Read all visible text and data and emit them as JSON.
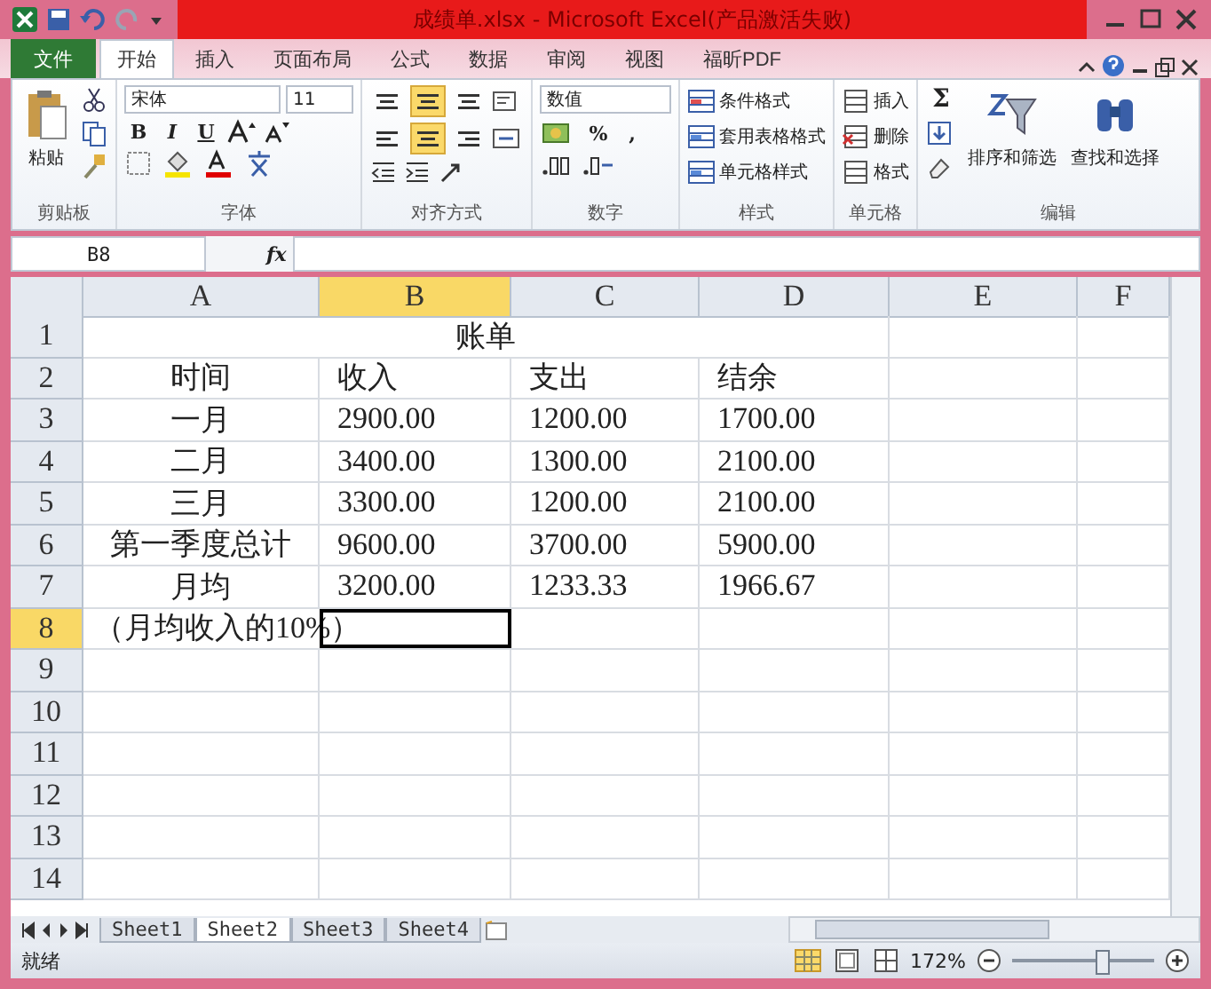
{
  "window": {
    "title": "成绩单.xlsx - Microsoft Excel(产品激活失败)"
  },
  "ribbon_tabs": [
    {
      "label": "文件",
      "kind": "file",
      "selected": false
    },
    {
      "label": "开始",
      "kind": "tab",
      "selected": true
    },
    {
      "label": "插入",
      "kind": "tab",
      "selected": false
    },
    {
      "label": "页面布局",
      "kind": "tab",
      "selected": false
    },
    {
      "label": "公式",
      "kind": "tab",
      "selected": false
    },
    {
      "label": "数据",
      "kind": "tab",
      "selected": false
    },
    {
      "label": "审阅",
      "kind": "tab",
      "selected": false
    },
    {
      "label": "视图",
      "kind": "tab",
      "selected": false
    },
    {
      "label": "福昕PDF",
      "kind": "tab",
      "selected": false
    }
  ],
  "clipboard": {
    "label": "剪贴板",
    "paste": "粘贴"
  },
  "font": {
    "label": "字体",
    "font_name": "宋体",
    "font_size": "11",
    "bold": "B",
    "italic": "I",
    "underline": "U"
  },
  "alignment": {
    "label": "对齐方式",
    "vertical_align": [
      {
        "selected": false
      },
      {
        "selected": true
      },
      {
        "selected": false
      }
    ],
    "horizontal_align": [
      {
        "selected": false
      },
      {
        "selected": true
      },
      {
        "selected": false
      }
    ]
  },
  "number": {
    "label": "数字",
    "format": "数值",
    "percent": "%",
    "comma": ","
  },
  "styles": {
    "label": "样式",
    "items": [
      "条件格式",
      "套用表格格式",
      "单元格样式"
    ]
  },
  "cells": {
    "label": "单元格",
    "items": [
      "插入",
      "删除",
      "格式"
    ]
  },
  "editing": {
    "label": "编辑",
    "sigma": "Σ",
    "items": [
      "排序和筛选",
      "查找和选择"
    ]
  },
  "formula_bar": {
    "name_box": "B8",
    "function_label": "fx"
  },
  "columns": [
    {
      "label": "A",
      "selected": false
    },
    {
      "label": "B",
      "selected": true
    },
    {
      "label": "C",
      "selected": false
    },
    {
      "label": "D",
      "selected": false
    },
    {
      "label": "E",
      "selected": false
    },
    {
      "label": "F",
      "selected": false
    }
  ],
  "rows": [
    {
      "number": "1",
      "selected": false,
      "kind": "merged",
      "text": "账单"
    },
    {
      "number": "2",
      "selected": false,
      "cells": [
        "时间",
        "收入",
        "支出",
        "结余"
      ]
    },
    {
      "number": "3",
      "selected": false,
      "cells": [
        "一月",
        "2900.00",
        "1200.00",
        "1700.00"
      ]
    },
    {
      "number": "4",
      "selected": false,
      "cells": [
        "二月",
        "3400.00",
        "1300.00",
        "2100.00"
      ]
    },
    {
      "number": "5",
      "selected": false,
      "cells": [
        "三月",
        "3300.00",
        "1200.00",
        "2100.00"
      ]
    },
    {
      "number": "6",
      "selected": false,
      "cells": [
        "第一季度总计",
        "9600.00",
        "3700.00",
        "5900.00"
      ]
    },
    {
      "number": "7",
      "selected": false,
      "cells": [
        "月均",
        "3200.00",
        "1233.33",
        "1966.67"
      ]
    },
    {
      "number": "8",
      "selected": true,
      "cells": [
        "（月均收入的10%）"
      ]
    },
    {
      "number": "9",
      "selected": false,
      "cells": []
    },
    {
      "number": "10",
      "selected": false,
      "cells": []
    },
    {
      "number": "11",
      "selected": false,
      "cells": []
    },
    {
      "number": "12",
      "selected": false,
      "cells": []
    },
    {
      "number": "13",
      "selected": false,
      "cells": []
    },
    {
      "number": "14",
      "selected": false,
      "cells": []
    }
  ],
  "sheets": [
    {
      "label": "Sheet1",
      "selected": false
    },
    {
      "label": "Sheet2",
      "selected": true
    },
    {
      "label": "Sheet3",
      "selected": false
    },
    {
      "label": "Sheet4",
      "selected": false
    }
  ],
  "status_bar": {
    "status": "就绪",
    "zoom": "172%",
    "zoom_slider": {
      "level": 0.62
    }
  }
}
